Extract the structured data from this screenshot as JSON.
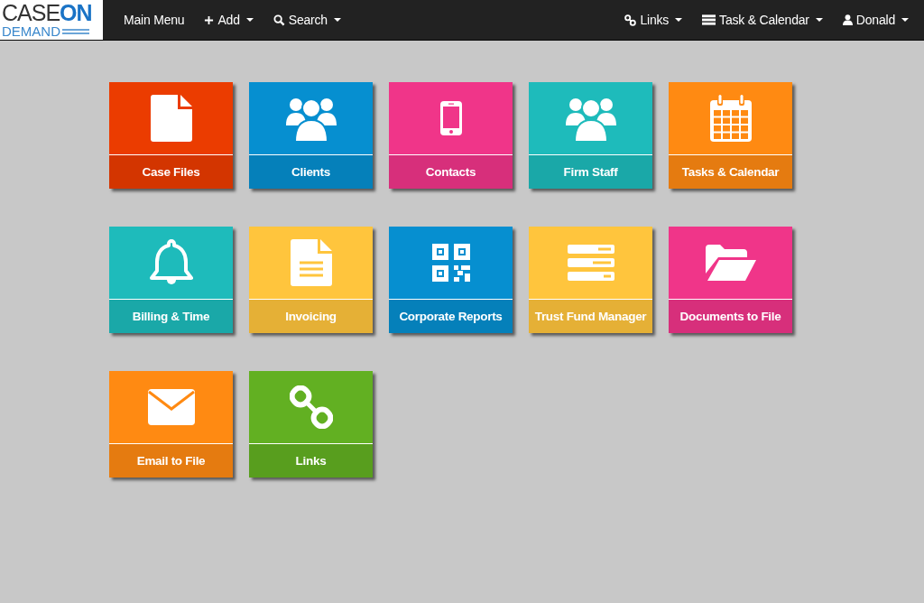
{
  "logo": {
    "word_1": "CASE",
    "word_2": "ON",
    "word_3": "DEMAND"
  },
  "nav_left": [
    {
      "label": "Main Menu",
      "dropdown": false
    },
    {
      "label": "Add",
      "dropdown": true
    },
    {
      "label": "Search",
      "dropdown": true
    }
  ],
  "nav_right": [
    {
      "label": "Links",
      "dropdown": true
    },
    {
      "label": "Task & Calendar",
      "dropdown": true
    },
    {
      "label": "Donald",
      "dropdown": true
    }
  ],
  "tiles": [
    {
      "label": "Case Files",
      "color": "#eb3c00"
    },
    {
      "label": "Clients",
      "color": "#068fd0"
    },
    {
      "label": "Contacts",
      "color": "#f03589"
    },
    {
      "label": "Firm Staff",
      "color": "#1ebbbb"
    },
    {
      "label": "Tasks & Calendar",
      "color": "#ff8a12"
    },
    {
      "label": "Billing & Time",
      "color": "#1ebbbb"
    },
    {
      "label": "Invoicing",
      "color": "#ffc53d"
    },
    {
      "label": "Corporate Reports",
      "color": "#068fd0"
    },
    {
      "label": "Trust Fund Manager",
      "color": "#ffc53d"
    },
    {
      "label": "Documents to File",
      "color": "#f03589"
    },
    {
      "label": "Email to File",
      "color": "#ff8a12"
    },
    {
      "label": "Links",
      "color": "#62b022"
    }
  ]
}
